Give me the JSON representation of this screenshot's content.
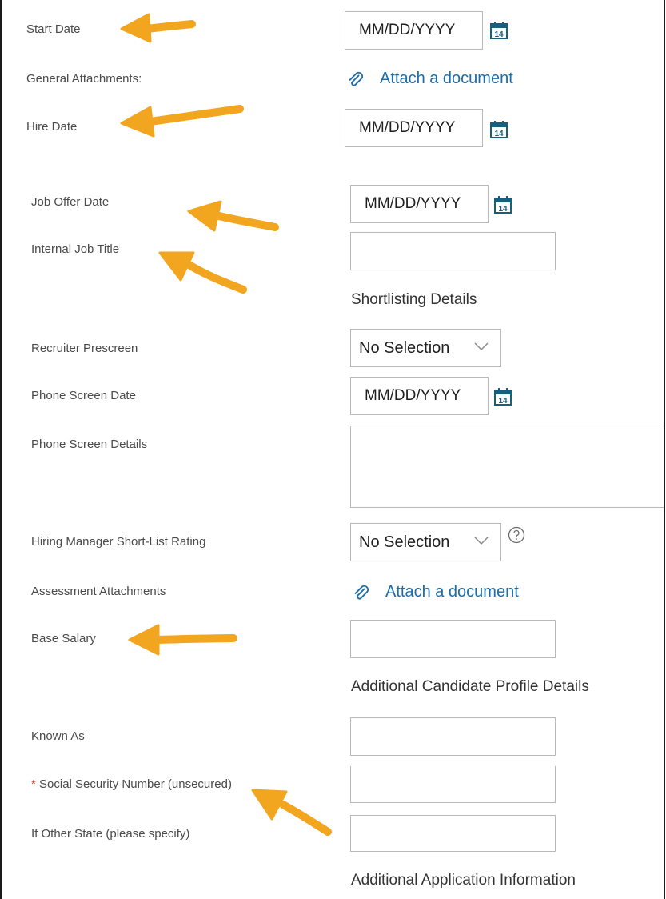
{
  "fields": {
    "start_date": {
      "label": "Start Date",
      "placeholder": "MM/DD/YYYY"
    },
    "general_attachments": {
      "label": "General Attachments:",
      "link": "Attach a document"
    },
    "hire_date": {
      "label": "Hire Date",
      "placeholder": "MM/DD/YYYY"
    },
    "job_offer_date": {
      "label": "Job Offer Date",
      "placeholder": "MM/DD/YYYY"
    },
    "internal_job_title": {
      "label": "Internal Job Title",
      "value": ""
    },
    "recruiter_prescreen": {
      "label": "Recruiter Prescreen",
      "selected": "No Selection"
    },
    "phone_screen_date": {
      "label": "Phone Screen Date",
      "placeholder": "MM/DD/YYYY"
    },
    "phone_screen_details": {
      "label": "Phone Screen Details",
      "value": ""
    },
    "hiring_manager_rating": {
      "label": "Hiring Manager Short-List Rating",
      "selected": "No Selection"
    },
    "assessment_attachments": {
      "label": "Assessment Attachments",
      "link": "Attach a document"
    },
    "base_salary": {
      "label": "Base Salary",
      "value": ""
    },
    "known_as": {
      "label": "Known As",
      "value": ""
    },
    "ssn": {
      "required_mark": "*",
      "label": "Social Security Number (unsecured)",
      "value": ""
    },
    "other_state": {
      "label": "If Other State (please specify)",
      "value": ""
    }
  },
  "sections": {
    "shortlisting": "Shortlisting Details",
    "additional_candidate": "Additional Candidate Profile Details",
    "additional_application": "Additional Application Information"
  },
  "calendar_icon_day": "14",
  "colors": {
    "accent_link": "#1b6cab",
    "arrow": "#f2a51e",
    "required": "#c0392b"
  },
  "icons": [
    "calendar-icon",
    "paperclip-icon",
    "chevron-down-icon",
    "help-circle-icon",
    "arrow-annotation"
  ]
}
